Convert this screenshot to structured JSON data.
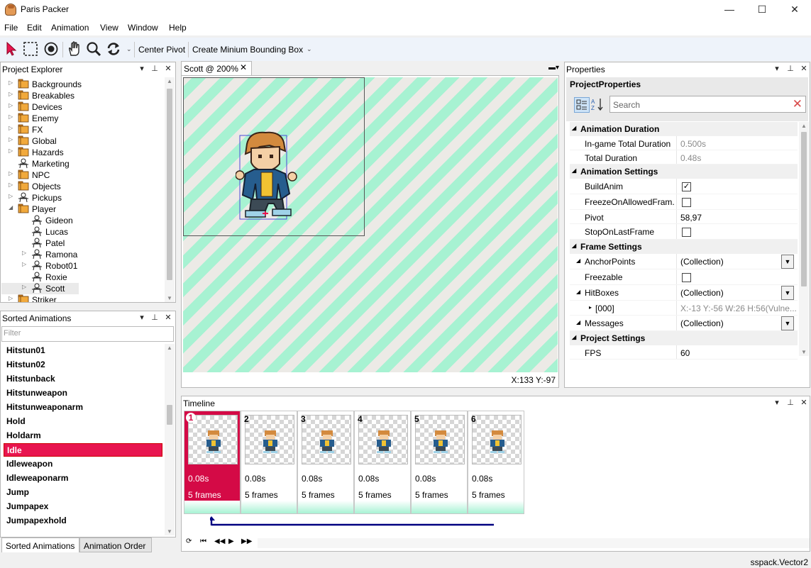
{
  "window": {
    "title": "Paris Packer",
    "minimize": "—",
    "maximize": "☐",
    "close": "✕"
  },
  "menu": [
    "File",
    "Edit",
    "Animation",
    "View",
    "Window",
    "Help"
  ],
  "toolbar": {
    "tools": [
      "pointer-tool",
      "marquee-select-tool",
      "record-tool",
      "pan-hand-tool",
      "zoom-tool",
      "refresh-tool"
    ],
    "center_pivot": "Center Pivot",
    "create_bbox": "Create Minium Bounding Box"
  },
  "project_explorer": {
    "title": "Project Explorer",
    "items": [
      {
        "label": "Backgrounds",
        "icon": "folder-icon",
        "level": 0,
        "expandable": true
      },
      {
        "label": "Breakables",
        "icon": "folder-icon",
        "level": 0,
        "expandable": true
      },
      {
        "label": "Devices",
        "icon": "folder-icon",
        "level": 0,
        "expandable": true
      },
      {
        "label": "Enemy",
        "icon": "folder-icon",
        "level": 0,
        "expandable": true
      },
      {
        "label": "FX",
        "icon": "folder-icon",
        "level": 0,
        "expandable": true
      },
      {
        "label": "Global",
        "icon": "folder-icon",
        "level": 0,
        "expandable": true
      },
      {
        "label": "Hazards",
        "icon": "folder-icon",
        "level": 0,
        "expandable": true
      },
      {
        "label": "Marketing",
        "icon": "sprite-icon",
        "level": 0,
        "expandable": false
      },
      {
        "label": "NPC",
        "icon": "folder-icon",
        "level": 0,
        "expandable": true
      },
      {
        "label": "Objects",
        "icon": "folder-icon",
        "level": 0,
        "expandable": true
      },
      {
        "label": "Pickups",
        "icon": "sprite-icon",
        "level": 0,
        "expandable": true
      },
      {
        "label": "Player",
        "icon": "folder-icon",
        "level": 0,
        "expandable": true,
        "expanded": true
      },
      {
        "label": "Gideon",
        "icon": "sprite-icon",
        "level": 1,
        "expandable": false
      },
      {
        "label": "Lucas",
        "icon": "sprite-icon",
        "level": 1,
        "expandable": false
      },
      {
        "label": "Patel",
        "icon": "sprite-icon",
        "level": 1,
        "expandable": false
      },
      {
        "label": "Ramona",
        "icon": "sprite-icon",
        "level": 1,
        "expandable": true
      },
      {
        "label": "Robot01",
        "icon": "sprite-icon",
        "level": 1,
        "expandable": true
      },
      {
        "label": "Roxie",
        "icon": "sprite-icon",
        "level": 1,
        "expandable": false
      },
      {
        "label": "Scott",
        "icon": "sprite-icon",
        "level": 1,
        "expandable": true,
        "selected": true
      },
      {
        "label": "Striker",
        "icon": "folder-icon",
        "level": 0,
        "expandable": true
      }
    ]
  },
  "sorted_animations": {
    "title": "Sorted Animations",
    "filter_placeholder": "Filter",
    "items": [
      "Hitstun01",
      "Hitstun02",
      "Hitstunback",
      "Hitstunweapon",
      "Hitstunweaponarm",
      "Hold",
      "Holdarm",
      "Idle",
      "Idleweapon",
      "Idleweaponarm",
      "Jump",
      "Jumpapex",
      "Jumpapexhold"
    ],
    "active": "Idle"
  },
  "bottom_tabs": [
    "Sorted Animations",
    "Animation Order"
  ],
  "document": {
    "tab_label": "Scott @ 200%",
    "close": "✕",
    "coords": "X:133 Y:-97"
  },
  "properties": {
    "title": "Properties",
    "header": "ProjectProperties",
    "search_placeholder": "Search",
    "rows": [
      {
        "type": "cat",
        "label": "Animation Duration"
      },
      {
        "type": "prop",
        "name": "In-game Total Duration",
        "value": "0.500s",
        "grey": true
      },
      {
        "type": "prop",
        "name": "Total Duration",
        "value": "0.48s",
        "grey": true
      },
      {
        "type": "cat",
        "label": "Animation Settings"
      },
      {
        "type": "check",
        "name": "BuildAnim",
        "checked": true
      },
      {
        "type": "check",
        "name": "FreezeOnAllowedFram...",
        "checked": false
      },
      {
        "type": "prop",
        "name": "Pivot",
        "value": "58,97"
      },
      {
        "type": "check",
        "name": "StopOnLastFrame",
        "checked": false
      },
      {
        "type": "cat",
        "label": "Frame Settings"
      },
      {
        "type": "dropdown",
        "name": "AnchorPoints",
        "value": "(Collection)",
        "expandable": true
      },
      {
        "type": "check",
        "name": "Freezable",
        "checked": false
      },
      {
        "type": "dropdown",
        "name": "HitBoxes",
        "value": "(Collection)",
        "expandable": true,
        "expanded": true
      },
      {
        "type": "sub",
        "name": "[000]",
        "value": "X:-13 Y:-56 W:26 H:56(Vulne..."
      },
      {
        "type": "dropdown",
        "name": "Messages",
        "value": "(Collection)",
        "expandable": true
      },
      {
        "type": "cat",
        "label": "Project Settings"
      },
      {
        "type": "prop",
        "name": "FPS",
        "value": "60"
      }
    ]
  },
  "timeline": {
    "title": "Timeline",
    "frames": [
      {
        "num": "1",
        "duration": "0.08s",
        "frames": "5 frames",
        "selected": true
      },
      {
        "num": "2",
        "duration": "0.08s",
        "frames": "5 frames"
      },
      {
        "num": "3",
        "duration": "0.08s",
        "frames": "5 frames"
      },
      {
        "num": "4",
        "duration": "0.08s",
        "frames": "5 frames"
      },
      {
        "num": "5",
        "duration": "0.08s",
        "frames": "5 frames"
      },
      {
        "num": "6",
        "duration": "0.08s",
        "frames": "5 frames"
      }
    ]
  },
  "status": "sspack.Vector2",
  "colors": {
    "accent": "#e8154f",
    "checker_mint": "#a7f2d2",
    "loop_arrow": "#000080"
  }
}
